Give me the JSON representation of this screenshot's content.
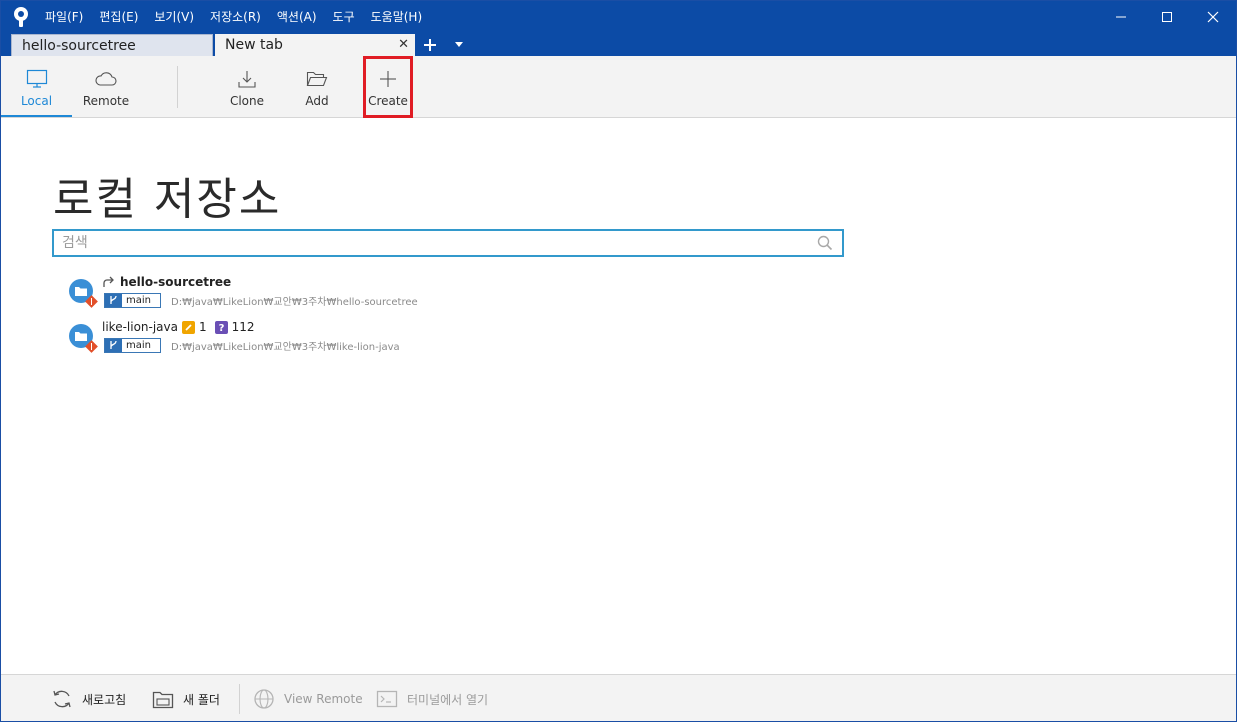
{
  "menu": [
    "파일(F)",
    "편집(E)",
    "보기(V)",
    "저장소(R)",
    "액션(A)",
    "도구",
    "도움말(H)"
  ],
  "tabs": {
    "inactive_label": "hello-sourcetree",
    "active_label": "New tab",
    "close_glyph": "✕"
  },
  "toolbar": {
    "local_label": "Local",
    "remote_label": "Remote",
    "clone_label": "Clone",
    "add_label": "Add",
    "create_label": "Create"
  },
  "page": {
    "title": "로컬 저장소"
  },
  "search": {
    "placeholder": "검색",
    "value": ""
  },
  "repos": [
    {
      "name": "hello-sourcetree",
      "branch": "main",
      "path": "D:₩java₩LikeLion₩교안₩3주차₩hello-sourcetree",
      "bold": true
    },
    {
      "name": "like-lion-java",
      "branch": "main",
      "path": "D:₩java₩LikeLion₩교안₩3주차₩like-lion-java",
      "modified_count": "1",
      "untracked_count": "112"
    }
  ],
  "statusbar": {
    "refresh_label": "새로고침",
    "new_folder_label": "새 폴더",
    "view_remote_label": "View Remote",
    "terminal_label": "터미널에서 열기"
  },
  "colors": {
    "titlebar": "#0c4ba6",
    "accent": "#1e88d6",
    "highlight": "#e01c24",
    "modified_badge": "#f0a500",
    "untracked_badge": "#6a4fb5",
    "repo_icon": "#3a8fd6",
    "repo_icon_mark": "#e2502a"
  },
  "icons": {
    "app": "sourcetree-logo-icon",
    "local": "monitor-icon",
    "remote": "cloud-icon",
    "clone": "download-icon",
    "add": "folder-open-icon",
    "create": "plus-icon",
    "search": "search-icon",
    "refresh": "refresh-icon",
    "new_folder": "folder-icon",
    "view_remote": "globe-icon",
    "terminal": "terminal-icon"
  }
}
